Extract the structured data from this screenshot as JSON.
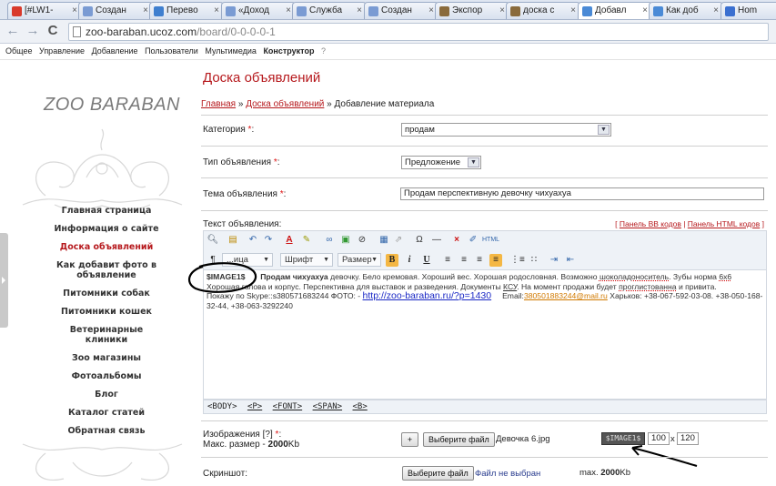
{
  "browser": {
    "tabs": [
      {
        "label": "[#LW1-",
        "color": "#d93a2b"
      },
      {
        "label": "Создан",
        "color": "#7a9bd3"
      },
      {
        "label": "Перево",
        "color": "#3f7fcf"
      },
      {
        "label": "«Доход",
        "color": "#7a9bd3"
      },
      {
        "label": "Служба",
        "color": "#7a9bd3"
      },
      {
        "label": "Создан",
        "color": "#7a9bd3"
      },
      {
        "label": "Экспор",
        "color": "#8a6b3c"
      },
      {
        "label": "доска с",
        "color": "#8a6b3c"
      },
      {
        "label": "Добавл",
        "color": "#4a8ad6"
      },
      {
        "label": "Как доб",
        "color": "#4a8ad6"
      },
      {
        "label": "Hom",
        "color": "#3a6fd0"
      }
    ],
    "url_host": "zoo-baraban.ucoz.com",
    "url_path": "/board/0-0-0-0-1"
  },
  "admin_bar": {
    "items": [
      "Общее",
      "Управление",
      "Добавление",
      "Пользователи",
      "Мультимедиа"
    ],
    "bold_item": "Конструктор",
    "help": "?"
  },
  "sidebar": {
    "logo": "ZOO BARABAN",
    "menu": [
      "Главная страница",
      "Информация о сайте",
      "Доска объявлений",
      "Как добавит фото в объявление",
      "Питомники собак",
      "Питомники кошек",
      "Ветеринарные клиники",
      "Зоо магазины",
      "Фотоальбомы",
      "Блог",
      "Каталог статей",
      "Обратная связь"
    ]
  },
  "page": {
    "title": "Доска объявлений",
    "breadcrumb": {
      "home": "Главная",
      "section": "Доска объявлений",
      "sep": "»",
      "current": "Добавление материала"
    }
  },
  "form": {
    "category_label": "Категория",
    "category_value": "продам",
    "type_label": "Тип объявления",
    "type_value": "Предложение",
    "topic_label": "Тема объявления",
    "topic_value": "Продам перспективную девочку чихуахуа",
    "text_label": "Текст объявления:",
    "bb_link": "Панель BB кодов",
    "html_link": "Панель HTML кодов",
    "toolbar": {
      "font": "Шрифт",
      "size": "Размер",
      "style": "...ица"
    },
    "editor": {
      "image_code": "$IMAGE1$",
      "bold_text": "Продам чихуахуа",
      "text1": " девочку. Бело кремовая. Хороший вес. Хорошая родословная. Возможно ",
      "chocolate": "шоколадоноситель",
      "text2": ". Зубы норма ",
      "six": "6х6",
      "text3": "Хорошая голова и корпус. Перспективна для выставок и разведения. Документы ",
      "ksu": "КСУ",
      "text4": ". На момент продажи будет ",
      "deworm": "проглистованна",
      "text5": " и привита.",
      "text6": "Покажу по Skype::s380571683244 ФОТО: - ",
      "site_link": "http://zoo-baraban.ru/?p=1430",
      "email_label": "Email:",
      "email": "380501883244@mail.ru",
      "text7": " Харьков: +38-067-592-03-08. +38-050-168-32-44, +38-063-3292240"
    },
    "path_tags": [
      "<BODY>",
      "<P>",
      "<FONT>",
      "<SPAN>",
      "<B>"
    ],
    "images_label": "Изображения",
    "images_help": "[?]",
    "max_size_label": "Макс. размер -",
    "max_size_value": "2000",
    "max_size_unit": "Kb",
    "plus": "+",
    "choose_file": "Выберите файл",
    "file_name": "Девочка 6.jpg",
    "image_code_box": "$IMAGE1$",
    "width": "100",
    "times": "x",
    "height": "120",
    "screenshot_label": "Скриншот:",
    "no_file": "Файл не выбран",
    "screenshot_max_label": "max.",
    "screenshot_max_value": "2000",
    "screenshot_max_unit": "Kb"
  }
}
